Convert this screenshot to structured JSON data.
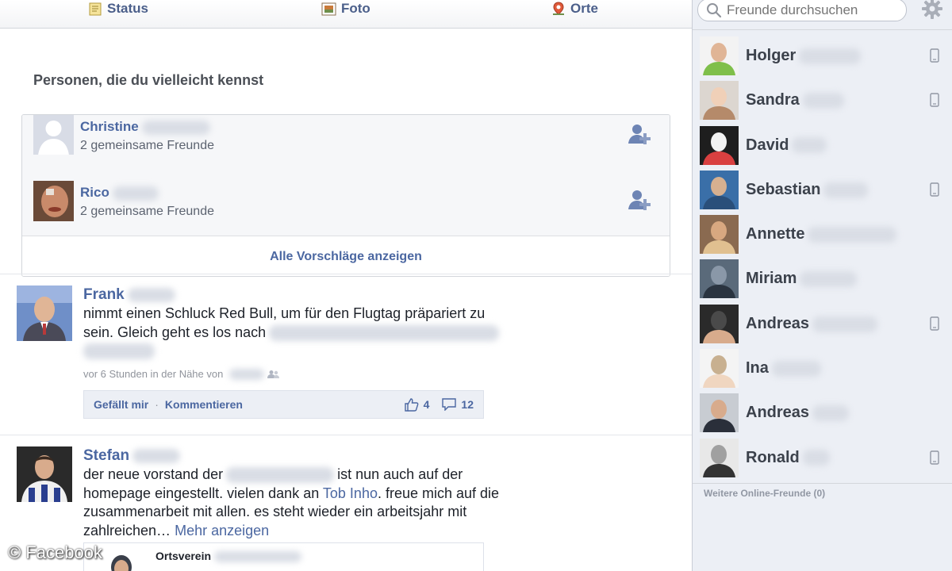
{
  "composer": {
    "status": "Status",
    "foto": "Foto",
    "orte": "Orte"
  },
  "pymk": {
    "title": "Personen, die du vielleicht kennst",
    "people": [
      {
        "name": "Christine",
        "mutual": "2 gemeinsame Freunde"
      },
      {
        "name": "Rico",
        "mutual": "2 gemeinsame Freunde"
      }
    ],
    "show_all": "Alle Vorschläge anzeigen"
  },
  "posts": [
    {
      "author": "Frank",
      "text_line1": "nimmt einen Schluck Red Bull, um für den Flugtag präpariert zu",
      "text_line2": "sein. Gleich geht es los nach",
      "meta": "vor 6 Stunden in der Nähe von",
      "like": "Gefällt mir",
      "comment": "Kommentieren",
      "likes": "4",
      "comments": "12"
    },
    {
      "author": "Stefan",
      "text_a": "der neue vorstand der",
      "text_b": "ist nun auch auf der",
      "text_c": "homepage eingestellt. vielen dank an",
      "mention": "Tob Inho",
      "text_d": ". freue mich auf die",
      "text_e": "zusammenarbeit mit allen. es steht wieder ein arbeitsjahr mit",
      "text_f": "zahlreichen…",
      "more": "Mehr anzeigen",
      "shared_name": "Ortsverein"
    }
  ],
  "watermark": "© Facebook",
  "sidebar": {
    "search_placeholder": "Freunde durchsuchen",
    "friends": [
      {
        "name": "Holger",
        "mobile": true
      },
      {
        "name": "Sandra",
        "mobile": true
      },
      {
        "name": "David",
        "mobile": false
      },
      {
        "name": "Sebastian",
        "mobile": true
      },
      {
        "name": "Annette",
        "mobile": false
      },
      {
        "name": "Miriam",
        "mobile": false
      },
      {
        "name": "Andreas",
        "mobile": true
      },
      {
        "name": "Ina",
        "mobile": false
      },
      {
        "name": "Andreas",
        "mobile": false
      },
      {
        "name": "Ronald",
        "mobile": true
      }
    ],
    "more_online": "Weitere Online-Freunde (0)"
  },
  "colors": {
    "link": "#4b67a1",
    "sidebar_bg": "#eceff5"
  }
}
